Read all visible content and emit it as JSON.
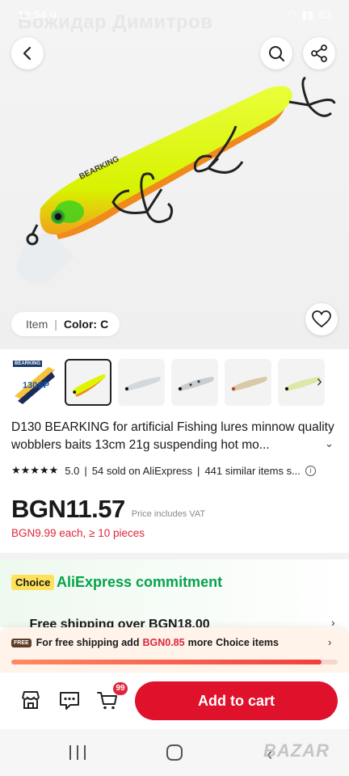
{
  "status": {
    "time": "19:54 ч.",
    "battery": "63"
  },
  "header": {
    "seller_name": "Божидар Димитров"
  },
  "hero": {
    "item_label": "Item",
    "color_label": "Color:",
    "color_value": "C",
    "lure_text": "BEARKING"
  },
  "thumbnails": [
    {
      "name": "package",
      "badge": "BEARKING"
    },
    {
      "name": "yellow",
      "badge": ""
    },
    {
      "name": "silver-1",
      "badge": ""
    },
    {
      "name": "silver-2",
      "badge": ""
    },
    {
      "name": "gold",
      "badge": ""
    },
    {
      "name": "green",
      "badge": ""
    }
  ],
  "product": {
    "title": "D130 BEARKING for artificial Fishing lures minnow quality wobblers baits 13cm 21g suspending hot mo...",
    "stars": "★★★★★",
    "rating": "5.0",
    "sold": "54 sold on AliExpress",
    "similar": "441 similar items s...",
    "price": "BGN11.57",
    "vat_note": "Price includes VAT",
    "bulk_price": "BGN9.99 each, ≥ 10 pieces"
  },
  "commitment": {
    "badge": "Choice",
    "title": "AliExpress commitment",
    "shipping": "Free shipping over BGN18.00"
  },
  "banner": {
    "tag": "FREE",
    "text_a": "For free shipping add",
    "amount": "BGN0.85",
    "text_b": "more",
    "text_c": "Choice items",
    "progress": 0.95
  },
  "bottom": {
    "cart_count": "99",
    "add_to_cart": "Add to cart"
  },
  "watermark": "BAZAR",
  "colors": {
    "accent": "#e0112b",
    "choice_green": "#03a34a",
    "choice_yellow": "#ffe25a"
  }
}
